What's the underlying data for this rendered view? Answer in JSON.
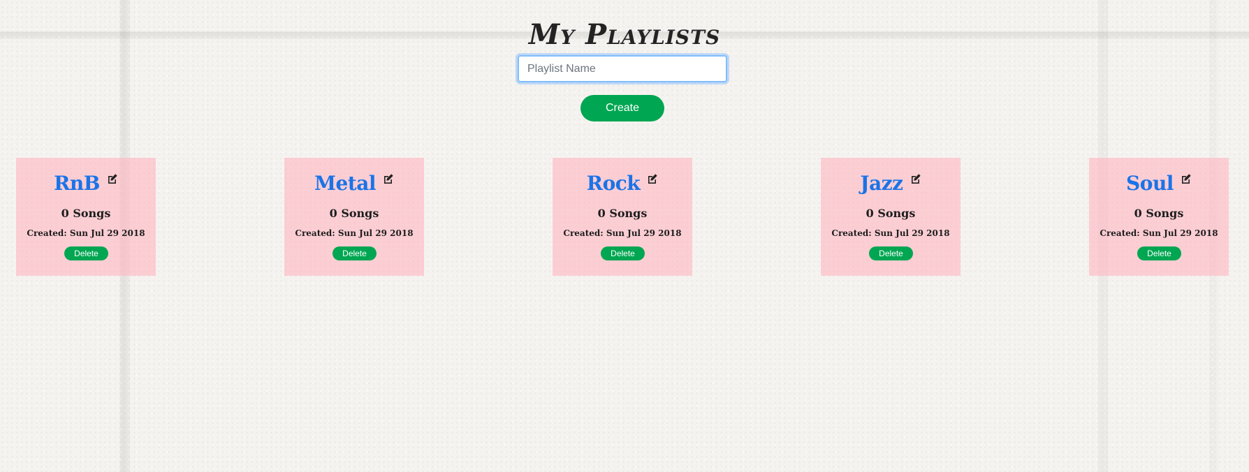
{
  "header": {
    "title": "My Playlists"
  },
  "form": {
    "input_value": "",
    "input_placeholder": "Playlist Name",
    "create_label": "Create"
  },
  "colors": {
    "accent_green": "#00a651",
    "card_pink": "#ffb6c1",
    "title_blue": "#1a73e8"
  },
  "playlists": [
    {
      "name": "RnB",
      "songs": "0 Songs",
      "created": "Created: Sun Jul 29 2018",
      "delete_label": "Delete",
      "edit_icon": "edit-icon"
    },
    {
      "name": "Metal",
      "songs": "0 Songs",
      "created": "Created: Sun Jul 29 2018",
      "delete_label": "Delete",
      "edit_icon": "edit-icon"
    },
    {
      "name": "Rock",
      "songs": "0 Songs",
      "created": "Created: Sun Jul 29 2018",
      "delete_label": "Delete",
      "edit_icon": "edit-icon"
    },
    {
      "name": "Jazz",
      "songs": "0 Songs",
      "created": "Created: Sun Jul 29 2018",
      "delete_label": "Delete",
      "edit_icon": "edit-icon"
    },
    {
      "name": "Soul",
      "songs": "0 Songs",
      "created": "Created: Sun Jul 29 2018",
      "delete_label": "Delete",
      "edit_icon": "edit-icon"
    }
  ]
}
